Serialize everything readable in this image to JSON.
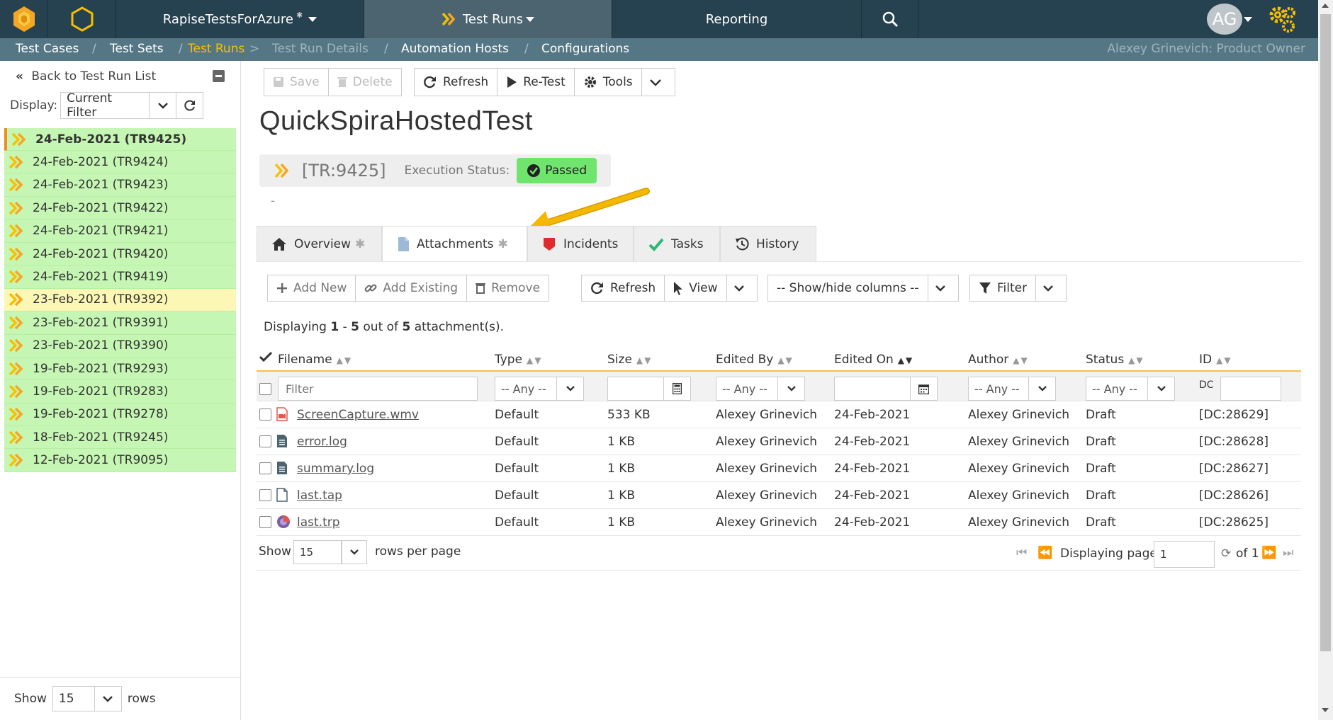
{
  "topnav": {
    "project": "RapiseTestsForAzure",
    "test_runs": "Test Runs",
    "reporting": "Reporting",
    "avatar_initials": "AG"
  },
  "breadcrumb": {
    "test_cases": "Test Cases",
    "sep1": "/",
    "test_sets": "Test Sets",
    "sep2": "/",
    "test_runs": "Test Runs",
    "sep3": ">",
    "test_run_details": "Test Run Details",
    "sep4": "/",
    "automation_hosts": "Automation Hosts",
    "sep5": "/",
    "configurations": "Configurations",
    "user": "Alexey Grinevich: Product Owner"
  },
  "sidebar": {
    "back_label": "Back to Test Run List",
    "display_label": "Display:",
    "filter_value": "Current Filter",
    "runs": [
      {
        "label": "24-Feb-2021 (TR9425)",
        "status": "passed",
        "selected": true
      },
      {
        "label": "24-Feb-2021 (TR9424)",
        "status": "passed"
      },
      {
        "label": "24-Feb-2021 (TR9423)",
        "status": "passed"
      },
      {
        "label": "24-Feb-2021 (TR9422)",
        "status": "passed"
      },
      {
        "label": "24-Feb-2021 (TR9421)",
        "status": "passed"
      },
      {
        "label": "24-Feb-2021 (TR9420)",
        "status": "passed"
      },
      {
        "label": "24-Feb-2021 (TR9419)",
        "status": "passed"
      },
      {
        "label": "23-Feb-2021 (TR9392)",
        "status": "caution"
      },
      {
        "label": "23-Feb-2021 (TR9391)",
        "status": "passed"
      },
      {
        "label": "23-Feb-2021 (TR9390)",
        "status": "passed"
      },
      {
        "label": "19-Feb-2021 (TR9293)",
        "status": "passed"
      },
      {
        "label": "19-Feb-2021 (TR9283)",
        "status": "passed"
      },
      {
        "label": "19-Feb-2021 (TR9278)",
        "status": "passed"
      },
      {
        "label": "18-Feb-2021 (TR9245)",
        "status": "passed"
      },
      {
        "label": "12-Feb-2021 (TR9095)",
        "status": "passed"
      }
    ],
    "footer_show": "Show",
    "footer_rows_value": "15",
    "footer_rows": "rows"
  },
  "toolbar": {
    "save": "Save",
    "delete": "Delete",
    "refresh": "Refresh",
    "retest": "Re-Test",
    "tools": "Tools"
  },
  "record": {
    "title": "QuickSpiraHostedTest",
    "id": "[TR:9425]",
    "exec_status_label": "Execution Status:",
    "exec_status": "Passed",
    "description": "-"
  },
  "tabs": [
    {
      "label": "Overview",
      "star": "✱"
    },
    {
      "label": "Attachments",
      "star": "✱"
    },
    {
      "label": "Incidents"
    },
    {
      "label": "Tasks"
    },
    {
      "label": "History"
    }
  ],
  "grid_toolbar": {
    "add_new": "Add New",
    "add_existing": "Add Existing",
    "remove": "Remove",
    "refresh": "Refresh",
    "view": "View",
    "show_hide": "-- Show/hide columns --",
    "filter": "Filter"
  },
  "count": {
    "prefix": "Displaying",
    "range_start": "1",
    "dash": "-",
    "range_end": "5",
    "middle": "out of",
    "total": "5",
    "suffix": "attachment(s)."
  },
  "table": {
    "columns": [
      "Filename",
      "Type",
      "Size",
      "Edited By",
      "Edited On",
      "Author",
      "Status",
      "ID"
    ],
    "filter_placeholder": "Filter",
    "any": "-- Any --",
    "dc_label": "DC",
    "rows": [
      {
        "filename": "ScreenCapture.wmv",
        "icon": "video-file-icon",
        "type": "Default",
        "size": "533 KB",
        "edited_by": "Alexey Grinevich",
        "edited_on": "24-Feb-2021",
        "author": "Alexey Grinevich",
        "status": "Draft",
        "id": "[DC:28629]"
      },
      {
        "filename": "error.log",
        "icon": "text-file-icon",
        "type": "Default",
        "size": "1 KB",
        "edited_by": "Alexey Grinevich",
        "edited_on": "24-Feb-2021",
        "author": "Alexey Grinevich",
        "status": "Draft",
        "id": "[DC:28628]"
      },
      {
        "filename": "summary.log",
        "icon": "text-file-icon",
        "type": "Default",
        "size": "1 KB",
        "edited_by": "Alexey Grinevich",
        "edited_on": "24-Feb-2021",
        "author": "Alexey Grinevich",
        "status": "Draft",
        "id": "[DC:28627]"
      },
      {
        "filename": "last.tap",
        "icon": "blank-file-icon",
        "type": "Default",
        "size": "1 KB",
        "edited_by": "Alexey Grinevich",
        "edited_on": "24-Feb-2021",
        "author": "Alexey Grinevich",
        "status": "Draft",
        "id": "[DC:28626]"
      },
      {
        "filename": "last.trp",
        "icon": "rapise-file-icon",
        "type": "Default",
        "size": "1 KB",
        "edited_by": "Alexey Grinevich",
        "edited_on": "24-Feb-2021",
        "author": "Alexey Grinevich",
        "status": "Draft",
        "id": "[DC:28625]"
      }
    ]
  },
  "pager": {
    "show": "Show",
    "rows_value": "15",
    "rows_per_page": "rows per page",
    "displaying_page": "Displaying page",
    "page": "1",
    "of": "of 1"
  },
  "colors": {
    "nav_bg": "#26414f",
    "crumb_bg": "#557785",
    "accent": "#f7c000",
    "passed_row": "#c6f6b4",
    "caution_row": "#fcf7b4",
    "passed_badge": "#6fe56d"
  }
}
